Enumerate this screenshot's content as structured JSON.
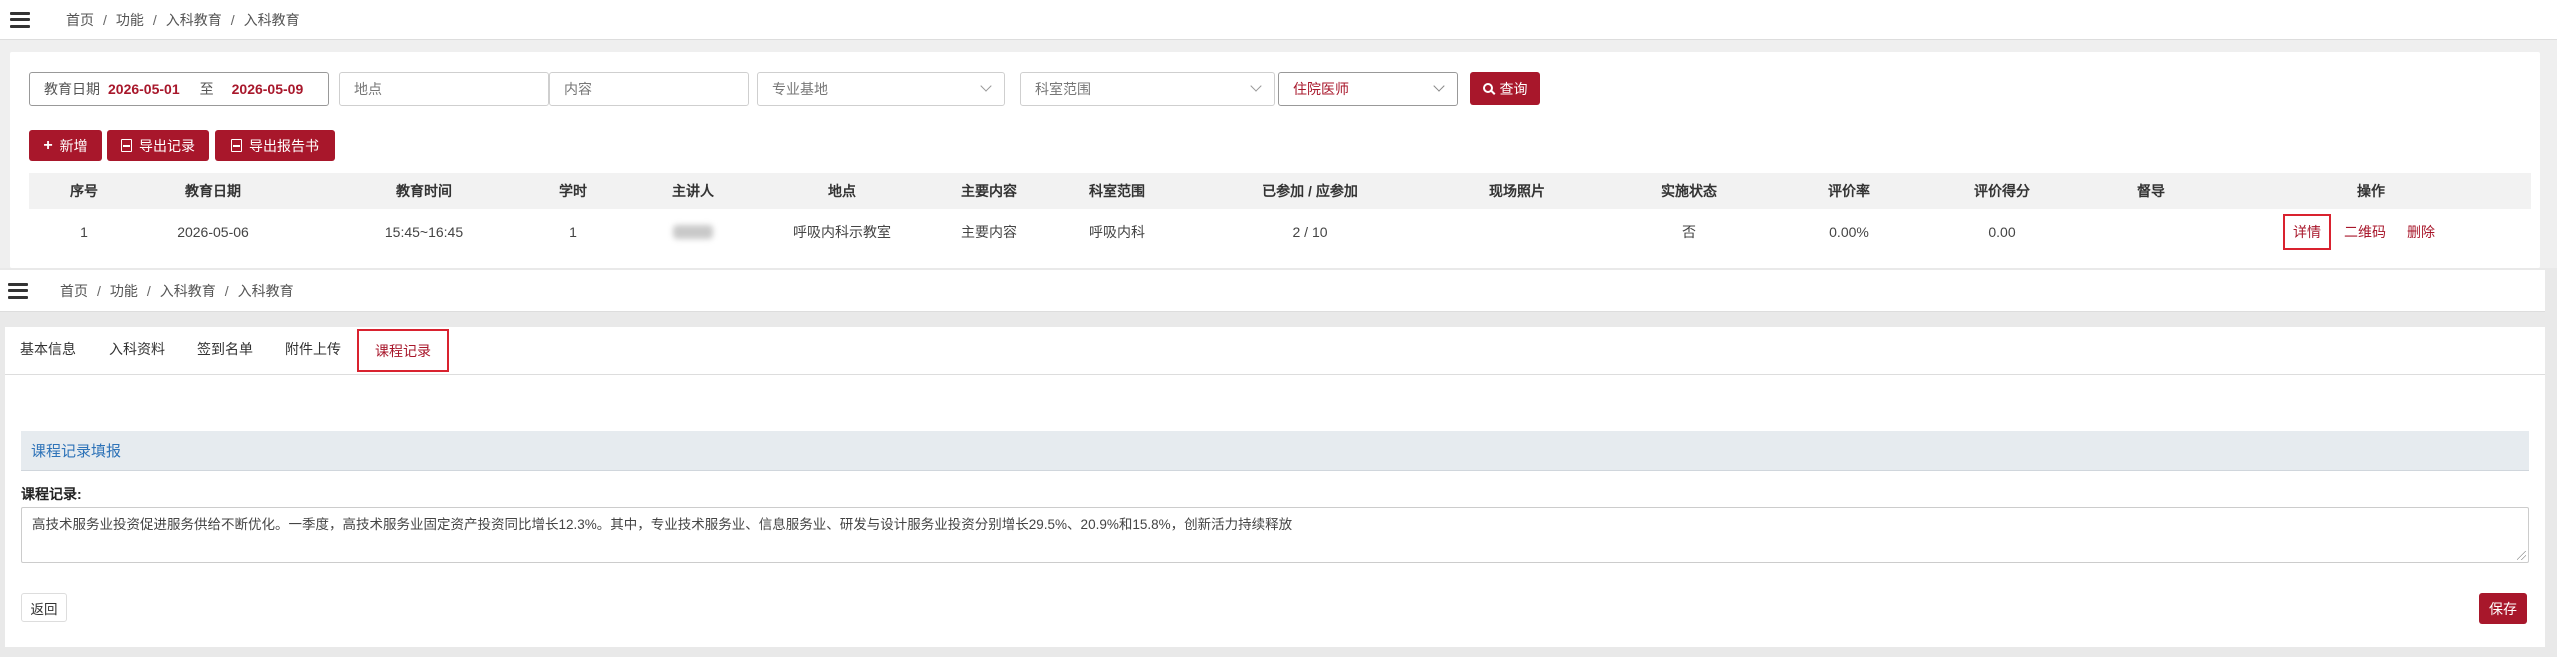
{
  "colors": {
    "accent": "#a8172b",
    "highlight": "#d9222f",
    "section_title": "#2e73b8"
  },
  "panel1": {
    "breadcrumb": [
      "首页",
      "功能",
      "入科教育",
      "入科教育"
    ],
    "filters": {
      "date_label": "教育日期",
      "date_from": "2026-05-01",
      "date_to_label": "至",
      "date_to": "2026-05-09",
      "location_placeholder": "地点",
      "content_placeholder": "内容",
      "base_placeholder": "专业基地",
      "dept_placeholder": "科室范围",
      "resident_value": "住院医师",
      "query_label": "查询"
    },
    "toolbar": {
      "add_label": "新增",
      "export_records_label": "导出记录",
      "export_report_label": "导出报告书"
    },
    "table": {
      "headers": [
        "序号",
        "教育日期",
        "教育时间",
        "学时",
        "主讲人",
        "地点",
        "主要内容",
        "科室范围",
        "已参加 / 应参加",
        "现场照片",
        "实施状态",
        "评价率",
        "评价得分",
        "督导",
        "操作"
      ],
      "row": {
        "index": "1",
        "date": "2026-05-06",
        "time": "15:45~16:45",
        "hours": "1",
        "speaker": "",
        "location": "呼吸内科示教室",
        "content": "主要内容",
        "dept": "呼吸内科",
        "attendance": "2 / 10",
        "photo": "",
        "status": "否",
        "eval_rate": "0.00%",
        "eval_score": "0.00",
        "supervisor": ""
      },
      "actions": {
        "detail": "详情",
        "qrcode": "二维码",
        "delete": "删除"
      }
    }
  },
  "panel2": {
    "breadcrumb": [
      "首页",
      "功能",
      "入科教育",
      "入科教育"
    ],
    "tabs": [
      "基本信息",
      "入科资料",
      "签到名单",
      "附件上传",
      "课程记录"
    ],
    "active_tab": "课程记录",
    "section_title": "课程记录填报",
    "record_label": "课程记录:",
    "record_text": "高技术服务业投资促进服务供给不断优化。一季度，高技术服务业固定资产投资同比增长12.3%。其中，专业技术服务业、信息服务业、研发与设计服务业投资分别增长29.5%、20.9%和15.8%，创新活力持续释放",
    "back_label": "返回",
    "save_label": "保存"
  }
}
